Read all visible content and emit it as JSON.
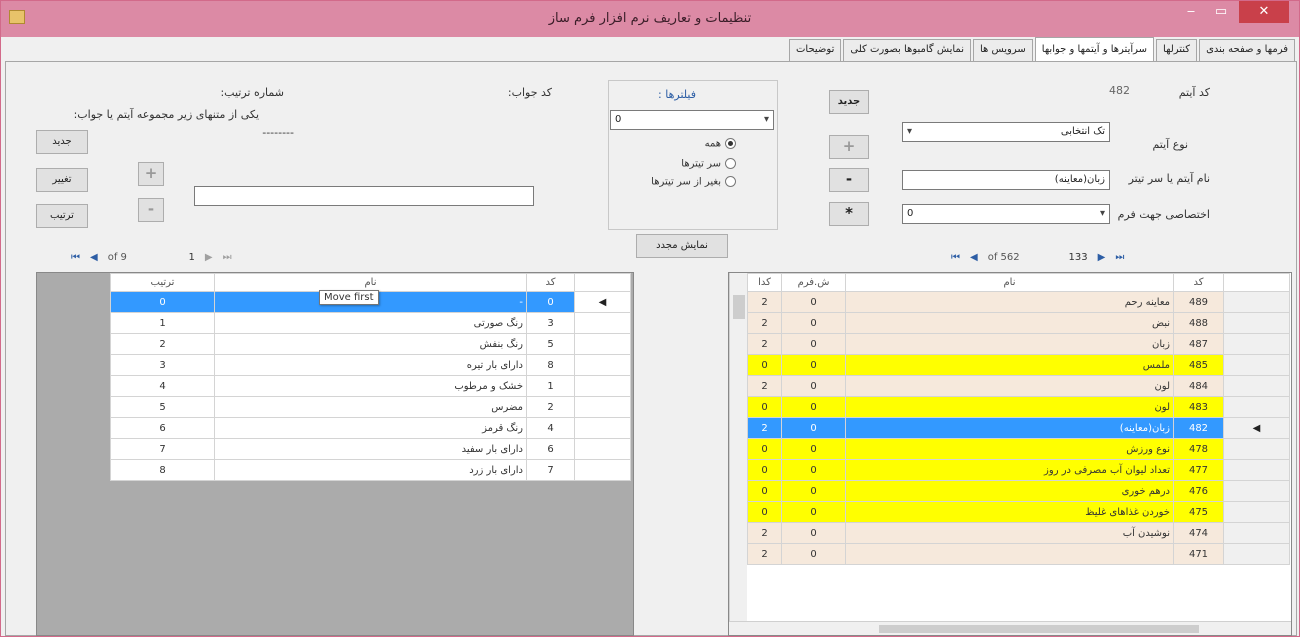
{
  "window": {
    "title": "تنظیمات و تعاریف نرم افزار فرم ساز",
    "colors": {
      "titlebar": "#dc8aa5",
      "close": "#c9404a",
      "yellow": "#ffff00",
      "selected": "#3399ff",
      "peach": "#f6e9dc"
    }
  },
  "tabs": [
    {
      "label": "فرمها و صفحه بندی"
    },
    {
      "label": "کنترلها"
    },
    {
      "label": "سرآیترها و آیتمها و جوابها"
    },
    {
      "label": "سرویس ها"
    },
    {
      "label": "نمایش گامبوها بصورت کلی"
    },
    {
      "label": "توضیحات"
    }
  ],
  "item_panel": {
    "code_label": "کد آیتم",
    "code_value": "482",
    "type_label": "نوع آیتم",
    "type_value": "تک انتخابی",
    "name_label": "نام آیتم یا سر تیتر",
    "name_value": "زبان(معاینه)",
    "assign_label": "اختصاصی جهت فرم",
    "assign_value": "0",
    "new_button": "جدید",
    "plus": "+",
    "minus": "-",
    "star": "*"
  },
  "filter_panel": {
    "title": "فیلترها :",
    "combo_value": "0",
    "radio_all": "همه",
    "radio_headers": "سر تیترها",
    "radio_except": "بغیر از سر تیترها",
    "refresh_button": "نمایش مجدد"
  },
  "answer_panel": {
    "code_label": "کد جواب:",
    "order_label": "شماره ترتیب:",
    "hint": "یکی از متنهای زیر مجموعه آیتم یا جواب:",
    "dashes": "--------",
    "text_value": "",
    "new_button": "جدید",
    "change_button": "تغییر",
    "order_button": "ترتیب",
    "plus": "+",
    "minus": "-"
  },
  "right_nav": {
    "position": "133",
    "of": "of 562"
  },
  "left_nav": {
    "position": "1",
    "of": "of 9"
  },
  "tooltip": "Move first",
  "right_grid": {
    "headers": {
      "code": "کد",
      "name": "نام",
      "form": "ش.فرم",
      "kd": "کدا"
    },
    "rows": [
      {
        "code": "489",
        "name": "معاینه رحم",
        "form": "0",
        "kd": "2",
        "style": "normal"
      },
      {
        "code": "488",
        "name": "نبض",
        "form": "0",
        "kd": "2",
        "style": "normal"
      },
      {
        "code": "487",
        "name": "زبان",
        "form": "0",
        "kd": "2",
        "style": "normal"
      },
      {
        "code": "485",
        "name": "ملمس",
        "form": "0",
        "kd": "0",
        "style": "yellow"
      },
      {
        "code": "484",
        "name": "لون",
        "form": "0",
        "kd": "2",
        "style": "normal"
      },
      {
        "code": "483",
        "name": "لون",
        "form": "0",
        "kd": "0",
        "style": "yellow"
      },
      {
        "code": "482",
        "name": "زبان(معاینه)",
        "form": "0",
        "kd": "2",
        "style": "selected"
      },
      {
        "code": "478",
        "name": "نوع ورزش",
        "form": "0",
        "kd": "0",
        "style": "yellow"
      },
      {
        "code": "477",
        "name": "تعداد لیوان آب مصرفی در روز",
        "form": "0",
        "kd": "0",
        "style": "yellow"
      },
      {
        "code": "476",
        "name": "درهم خوری",
        "form": "0",
        "kd": "0",
        "style": "yellow"
      },
      {
        "code": "475",
        "name": "خوردن غذاهای غلیظ",
        "form": "0",
        "kd": "0",
        "style": "yellow"
      },
      {
        "code": "474",
        "name": "نوشیدن آب",
        "form": "0",
        "kd": "2",
        "style": "normal"
      },
      {
        "code": "471",
        "name": "",
        "form": "0",
        "kd": "2",
        "style": "normal"
      }
    ]
  },
  "left_grid": {
    "headers": {
      "code": "کد",
      "name": "نام",
      "order": "ترتیب"
    },
    "rows": [
      {
        "code": "0",
        "name": "-",
        "order": "0",
        "style": "selected"
      },
      {
        "code": "3",
        "name": "رنگ صورتی",
        "order": "1",
        "style": "normal"
      },
      {
        "code": "5",
        "name": "رنگ بنفش",
        "order": "2",
        "style": "normal"
      },
      {
        "code": "8",
        "name": "دارای بار تیره",
        "order": "3",
        "style": "normal"
      },
      {
        "code": "1",
        "name": "خشک و مرطوب",
        "order": "4",
        "style": "normal"
      },
      {
        "code": "2",
        "name": "مضرس",
        "order": "5",
        "style": "normal"
      },
      {
        "code": "4",
        "name": "رنگ قرمز",
        "order": "6",
        "style": "normal"
      },
      {
        "code": "6",
        "name": "دارای بار سفید",
        "order": "7",
        "style": "normal"
      },
      {
        "code": "7",
        "name": "دارای بار زرد",
        "order": "8",
        "style": "normal"
      }
    ]
  }
}
